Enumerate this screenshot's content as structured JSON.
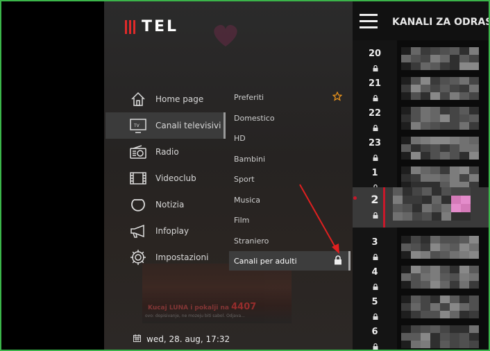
{
  "logo": {
    "text": "TEL"
  },
  "nav": [
    {
      "label": "Home page",
      "icon": "home-icon"
    },
    {
      "label": "Canali televisivi",
      "icon": "tv-icon"
    },
    {
      "label": "Radio",
      "icon": "radio-icon"
    },
    {
      "label": "Videoclub",
      "icon": "film-icon"
    },
    {
      "label": "Notizia",
      "icon": "news-icon"
    },
    {
      "label": "Infoplay",
      "icon": "megaphone-icon"
    },
    {
      "label": "Impostazioni",
      "icon": "gear-icon"
    }
  ],
  "nav_active_index": 1,
  "sub_nav": [
    {
      "label": "Preferiti",
      "icon": "star-icon"
    },
    {
      "label": "Domestico"
    },
    {
      "label": "HD"
    },
    {
      "label": "Bambini"
    },
    {
      "label": "Sport"
    },
    {
      "label": "Musica"
    },
    {
      "label": "Film"
    },
    {
      "label": "Straniero"
    },
    {
      "label": "Canali per adulti",
      "icon": "lock-icon"
    }
  ],
  "sub_nav_active_index": 8,
  "datetime": "wed, 28. aug, 17:32",
  "background_promo": {
    "text": "Kucaj LUNA i pokalji na",
    "number": "4407",
    "sub": "ovo: dopisivanje, ne mozeju biti sabol. Odjava..."
  },
  "right_panel": {
    "title": "KANALI ZA ODRAS"
  },
  "channels": [
    "20",
    "21",
    "22",
    "23",
    "1",
    "2",
    "3",
    "4",
    "5",
    "6"
  ],
  "selected_channel": "2",
  "colors": {
    "accent": "#c8182a",
    "star": "#e8921c",
    "annotation_arrow": "#e02020",
    "frame": "#3bb54a"
  }
}
